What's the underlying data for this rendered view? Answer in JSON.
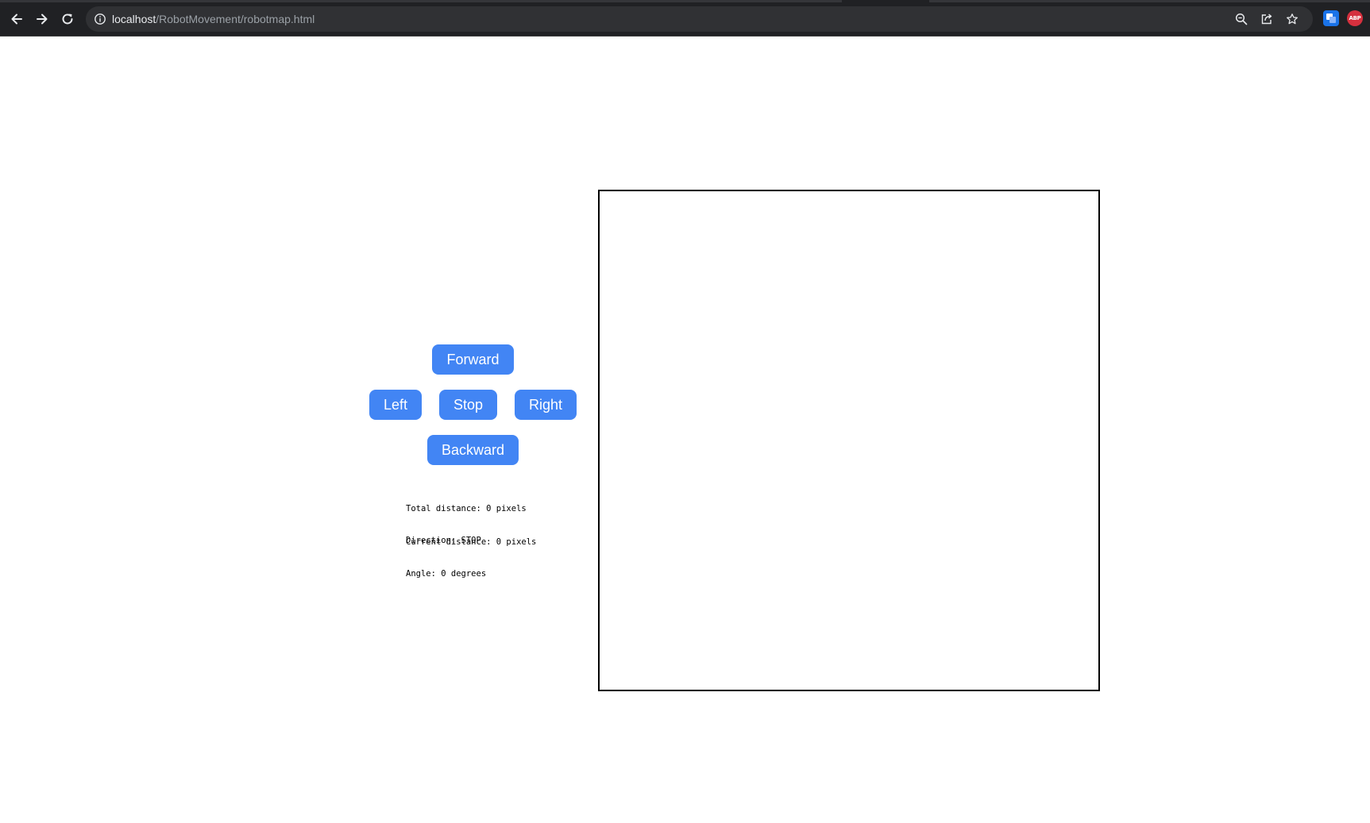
{
  "browser": {
    "url_host": "localhost",
    "url_path": "/RobotMovement/robotmap.html",
    "icons": {
      "back": "arrow-left-icon",
      "forward": "arrow-right-icon",
      "reload": "reload-icon",
      "site_info": "info-icon",
      "zoom": "zoom-icon",
      "share": "share-icon",
      "bookmark": "star-icon"
    },
    "extensions": {
      "abp_label": "ABP"
    }
  },
  "controls": {
    "forward_label": "Forward",
    "left_label": "Left",
    "stop_label": "Stop",
    "right_label": "Right",
    "backward_label": "Backward",
    "button_color": "#4285f4"
  },
  "stats": {
    "total_distance": "Total distance: 0 pixels",
    "current_distance": "Current distance: 0 pixels",
    "direction": "Direction: STOP",
    "angle": "Angle: 0 degrees"
  }
}
